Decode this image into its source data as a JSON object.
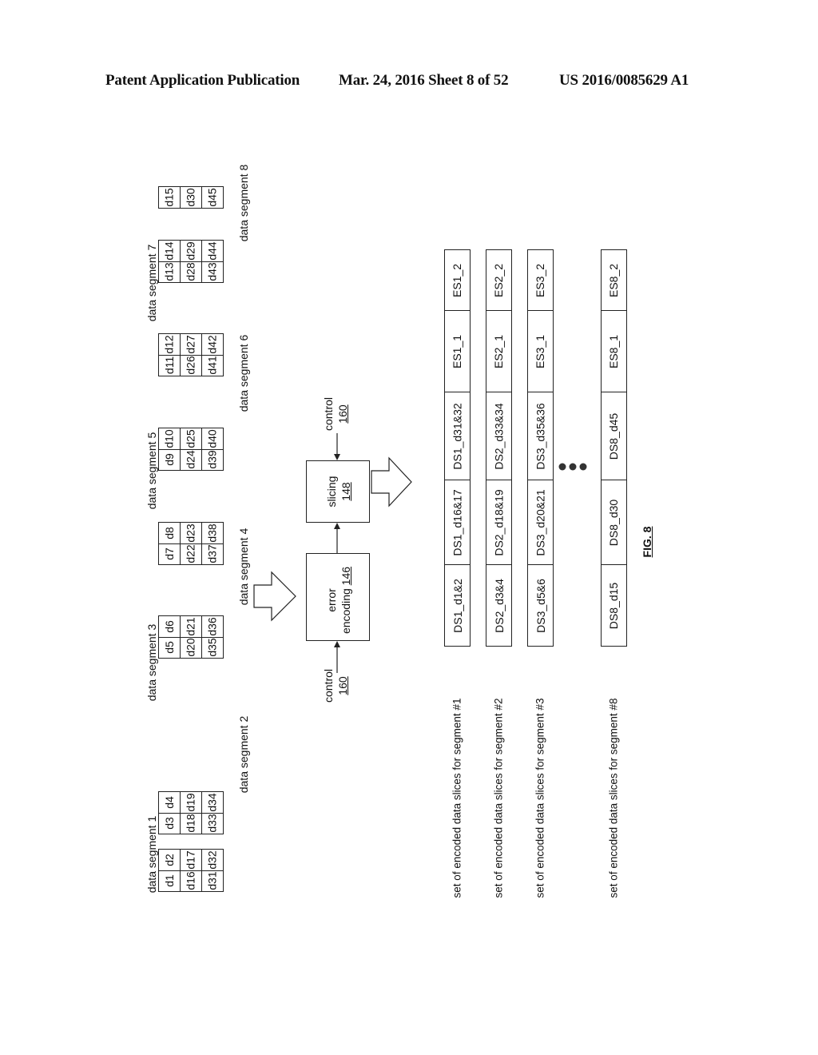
{
  "header": {
    "publication": "Patent Application Publication",
    "date_sheet": "Mar. 24, 2016  Sheet 8 of 52",
    "number": "US 2016/0085629 A1"
  },
  "segments": [
    {
      "label": "data segment 1",
      "cells": [
        [
          "d1",
          "d2"
        ],
        [
          "d16",
          "d17"
        ],
        [
          "d31",
          "d32"
        ]
      ]
    },
    {
      "label": "data segment 2",
      "cells": [
        [
          "d3",
          "d4"
        ],
        [
          "d18",
          "d19"
        ],
        [
          "d33",
          "d34"
        ]
      ]
    },
    {
      "label": "data segment 3",
      "cells": [
        [
          "d5",
          "d6"
        ],
        [
          "d20",
          "d21"
        ],
        [
          "d35",
          "d36"
        ]
      ]
    },
    {
      "label": "data segment 4",
      "cells": [
        [
          "d7",
          "d8"
        ],
        [
          "d22",
          "d23"
        ],
        [
          "d37",
          "d38"
        ]
      ]
    },
    {
      "label": "data segment 5",
      "cells": [
        [
          "d9",
          "d10"
        ],
        [
          "d24",
          "d25"
        ],
        [
          "d39",
          "d40"
        ]
      ]
    },
    {
      "label": "data segment 6",
      "cells": [
        [
          "d11",
          "d12"
        ],
        [
          "d26",
          "d27"
        ],
        [
          "d41",
          "d42"
        ]
      ]
    },
    {
      "label": "data segment 7",
      "cells": [
        [
          "d13",
          "d14"
        ],
        [
          "d28",
          "d29"
        ],
        [
          "d43",
          "d44"
        ]
      ]
    },
    {
      "label": "data segment 8",
      "cells": [
        [
          "d15"
        ],
        [
          "d30"
        ],
        [
          "d45"
        ]
      ]
    }
  ],
  "blocks": {
    "error_encoding": {
      "label": "error",
      "label2": "encoding",
      "ref": "146"
    },
    "slicing": {
      "label": "slicing",
      "ref": "148"
    },
    "control_left": {
      "label": "control",
      "ref": "160"
    },
    "control_right": {
      "label": "control",
      "ref": "160"
    }
  },
  "slice_sets": [
    {
      "label": "set of encoded data slices for segment #1",
      "slices": [
        "DS1_d1&2",
        "DS1_d16&17",
        "DS1_d31&32",
        "ES1_1",
        "ES1_2"
      ]
    },
    {
      "label": "set of encoded data slices for segment #2",
      "slices": [
        "DS2_d3&4",
        "DS2_d18&19",
        "DS2_d33&34",
        "ES2_1",
        "ES2_2"
      ]
    },
    {
      "label": "set of encoded data slices for segment #3",
      "slices": [
        "DS3_d5&6",
        "DS3_d20&21",
        "DS3_d35&36",
        "ES3_1",
        "ES3_2"
      ]
    },
    {
      "label": "set of encoded data slices for segment #8",
      "slices": [
        "DS8_d15",
        "DS8_d30",
        "DS8_d45",
        "ES8_1",
        "ES8_2"
      ]
    }
  ],
  "figure_label": "FIG. 8"
}
